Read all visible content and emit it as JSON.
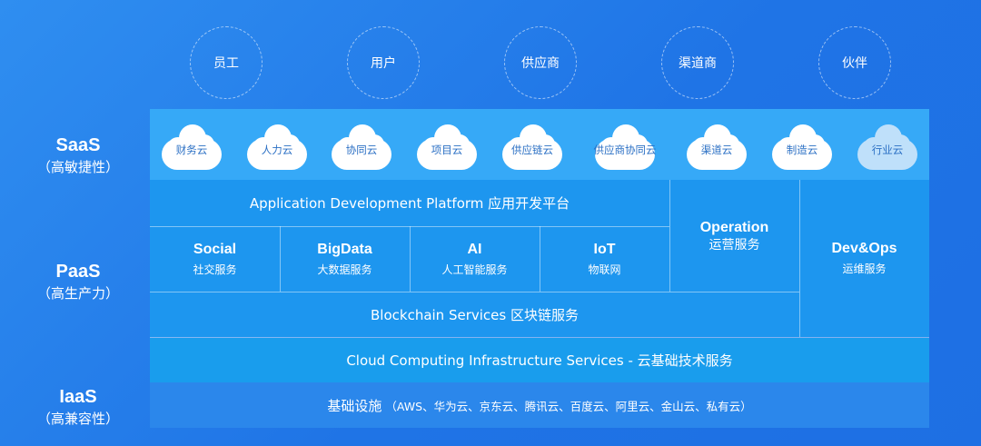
{
  "roles": [
    "员工",
    "用户",
    "供应商",
    "渠道商",
    "伙伴"
  ],
  "layers": {
    "saas": {
      "title": "SaaS",
      "subtitle": "（高敏捷性）"
    },
    "paas": {
      "title": "PaaS",
      "subtitle": "（高生产力）"
    },
    "iaas": {
      "title": "IaaS",
      "subtitle": "（高兼容性）"
    }
  },
  "saas_clouds": [
    "财务云",
    "人力云",
    "协同云",
    "项目云",
    "供应链云",
    "供应商协同云",
    "渠道云",
    "制造云",
    "行业云"
  ],
  "paas": {
    "app_platform": "Application Development Platform  应用开发平台",
    "services": [
      {
        "title": "Social",
        "sub": "社交服务"
      },
      {
        "title": "BigData",
        "sub": "大数据服务"
      },
      {
        "title": "AI",
        "sub": "人工智能服务"
      },
      {
        "title": "IoT",
        "sub": "物联网"
      }
    ],
    "operation": {
      "title": "Operation",
      "sub": "运营服务"
    },
    "devops": {
      "title": "Dev&Ops",
      "sub": "运维服务"
    },
    "blockchain": "Blockchain Services 区块链服务"
  },
  "infra": "Cloud Computing Infrastructure Services - 云基础技术服务",
  "iaas": {
    "main": "基础设施",
    "detail": "（AWS、华为云、京东云、腾讯云、百度云、阿里云、金山云、私有云）"
  },
  "colors": {
    "background": "#1f74e6",
    "saas_band": "#36a9f7",
    "paas_band": "#1d96ef",
    "infra_band": "#199ded",
    "iaas_band": "#2b87eb",
    "cloud_label": "#2a6fc4"
  }
}
